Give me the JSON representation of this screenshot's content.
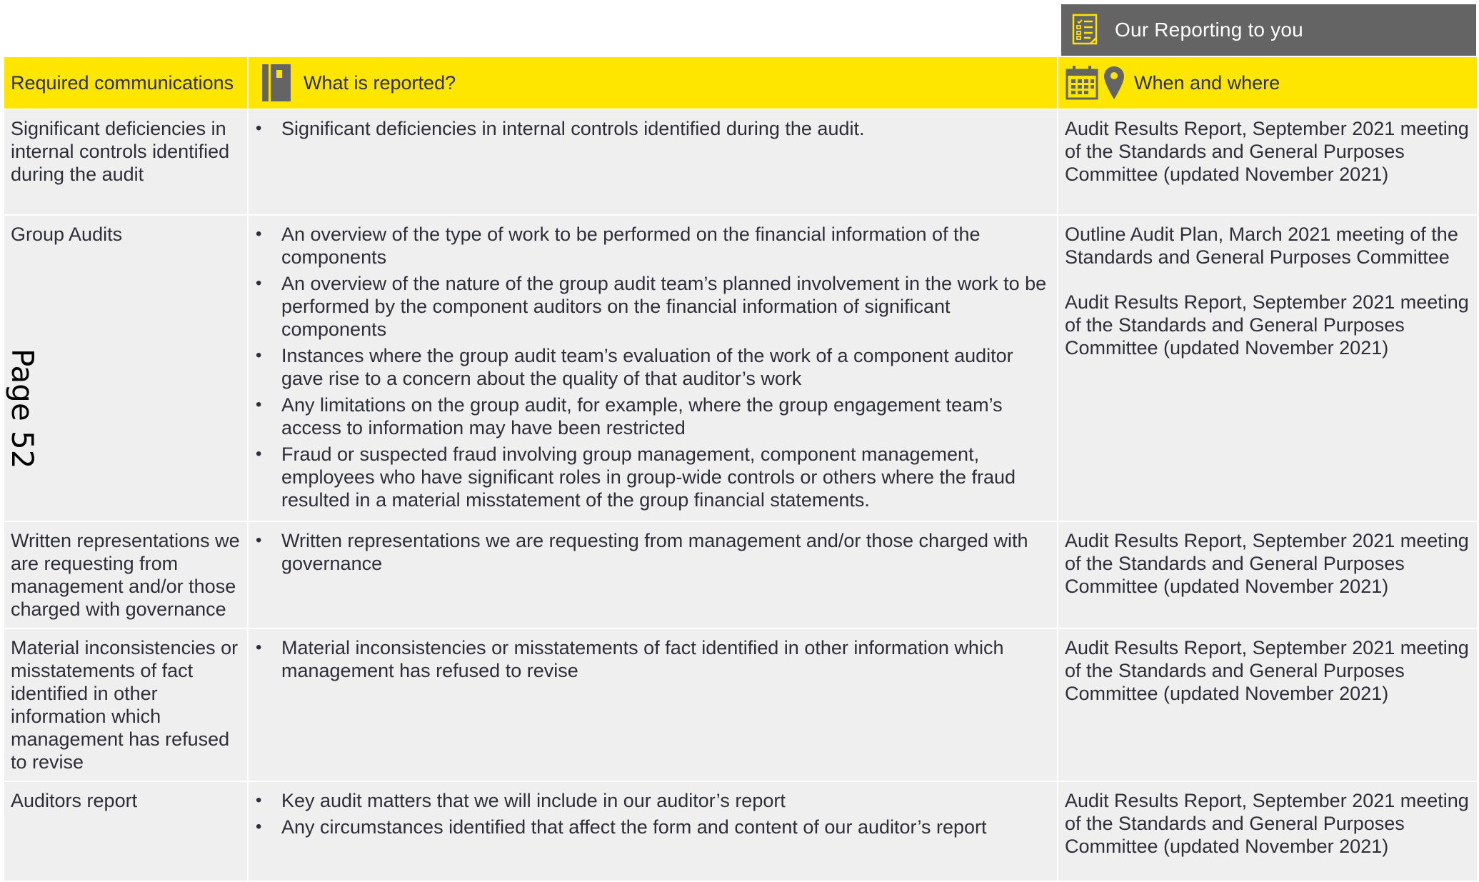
{
  "banner": {
    "title": "Our Reporting to you",
    "icon": "report-list-icon"
  },
  "headers": {
    "col1": "Required communications",
    "col2": "What is reported?",
    "col2_icon": "notebook-icon",
    "col3": "When and where",
    "col3_icons": [
      "calendar-icon",
      "location-pin-icon"
    ]
  },
  "rows": [
    {
      "communication": "Significant deficiencies in internal controls identified during the audit",
      "reported": [
        "Significant deficiencies in internal controls identified during the audit."
      ],
      "when": [
        "Audit Results Report, September 2021 meeting of the Standards and General Purposes Committee (updated November 2021)"
      ]
    },
    {
      "communication": "Group Audits",
      "reported": [
        "An overview of the type of work to be performed on the financial information of the components",
        "An overview of the nature of the group audit team’s planned involvement in the work to be performed by the component auditors on the financial information of significant components",
        "Instances where the group audit team’s evaluation of the work of a component auditor gave rise to a concern about the quality of that auditor’s work",
        "Any limitations on the group audit, for example, where the group engagement team’s access to information may have been restricted",
        "Fraud or suspected fraud involving group management, component management, employees who have significant roles in group-wide controls or others where the fraud resulted in a material misstatement of the group financial statements."
      ],
      "when": [
        "Outline Audit Plan, March 2021 meeting of the Standards and General Purposes Committee",
        "Audit Results Report, September 2021 meeting of the Standards and General Purposes Committee (updated November 2021)"
      ]
    },
    {
      "communication": "Written representations we are requesting from management and/or those charged with governance",
      "reported": [
        "Written representations we are requesting from management and/or those charged with governance"
      ],
      "when": [
        "Audit Results Report, September 2021 meeting of the Standards and General Purposes Committee (updated November 2021)"
      ]
    },
    {
      "communication": "Material inconsistencies or misstatements of fact identified in other information which management has refused to revise",
      "reported": [
        "Material inconsistencies or misstatements of fact identified in other information which management has refused to revise"
      ],
      "when": [
        "Audit Results Report, September 2021 meeting of the Standards and General Purposes Committee (updated November 2021)"
      ]
    },
    {
      "communication": "Auditors report",
      "reported": [
        "Key audit matters that we will include in our auditor’s report",
        "Any circumstances identified that affect the form and content of our auditor’s report"
      ],
      "when": [
        "Audit Results Report, September 2021 meeting of the Standards and General Purposes Committee (updated November 2021)"
      ]
    }
  ],
  "page_label": "Page 52",
  "colors": {
    "accent_yellow": "#ffe600",
    "banner_grey": "#646464",
    "cell_grey": "#efefef"
  }
}
